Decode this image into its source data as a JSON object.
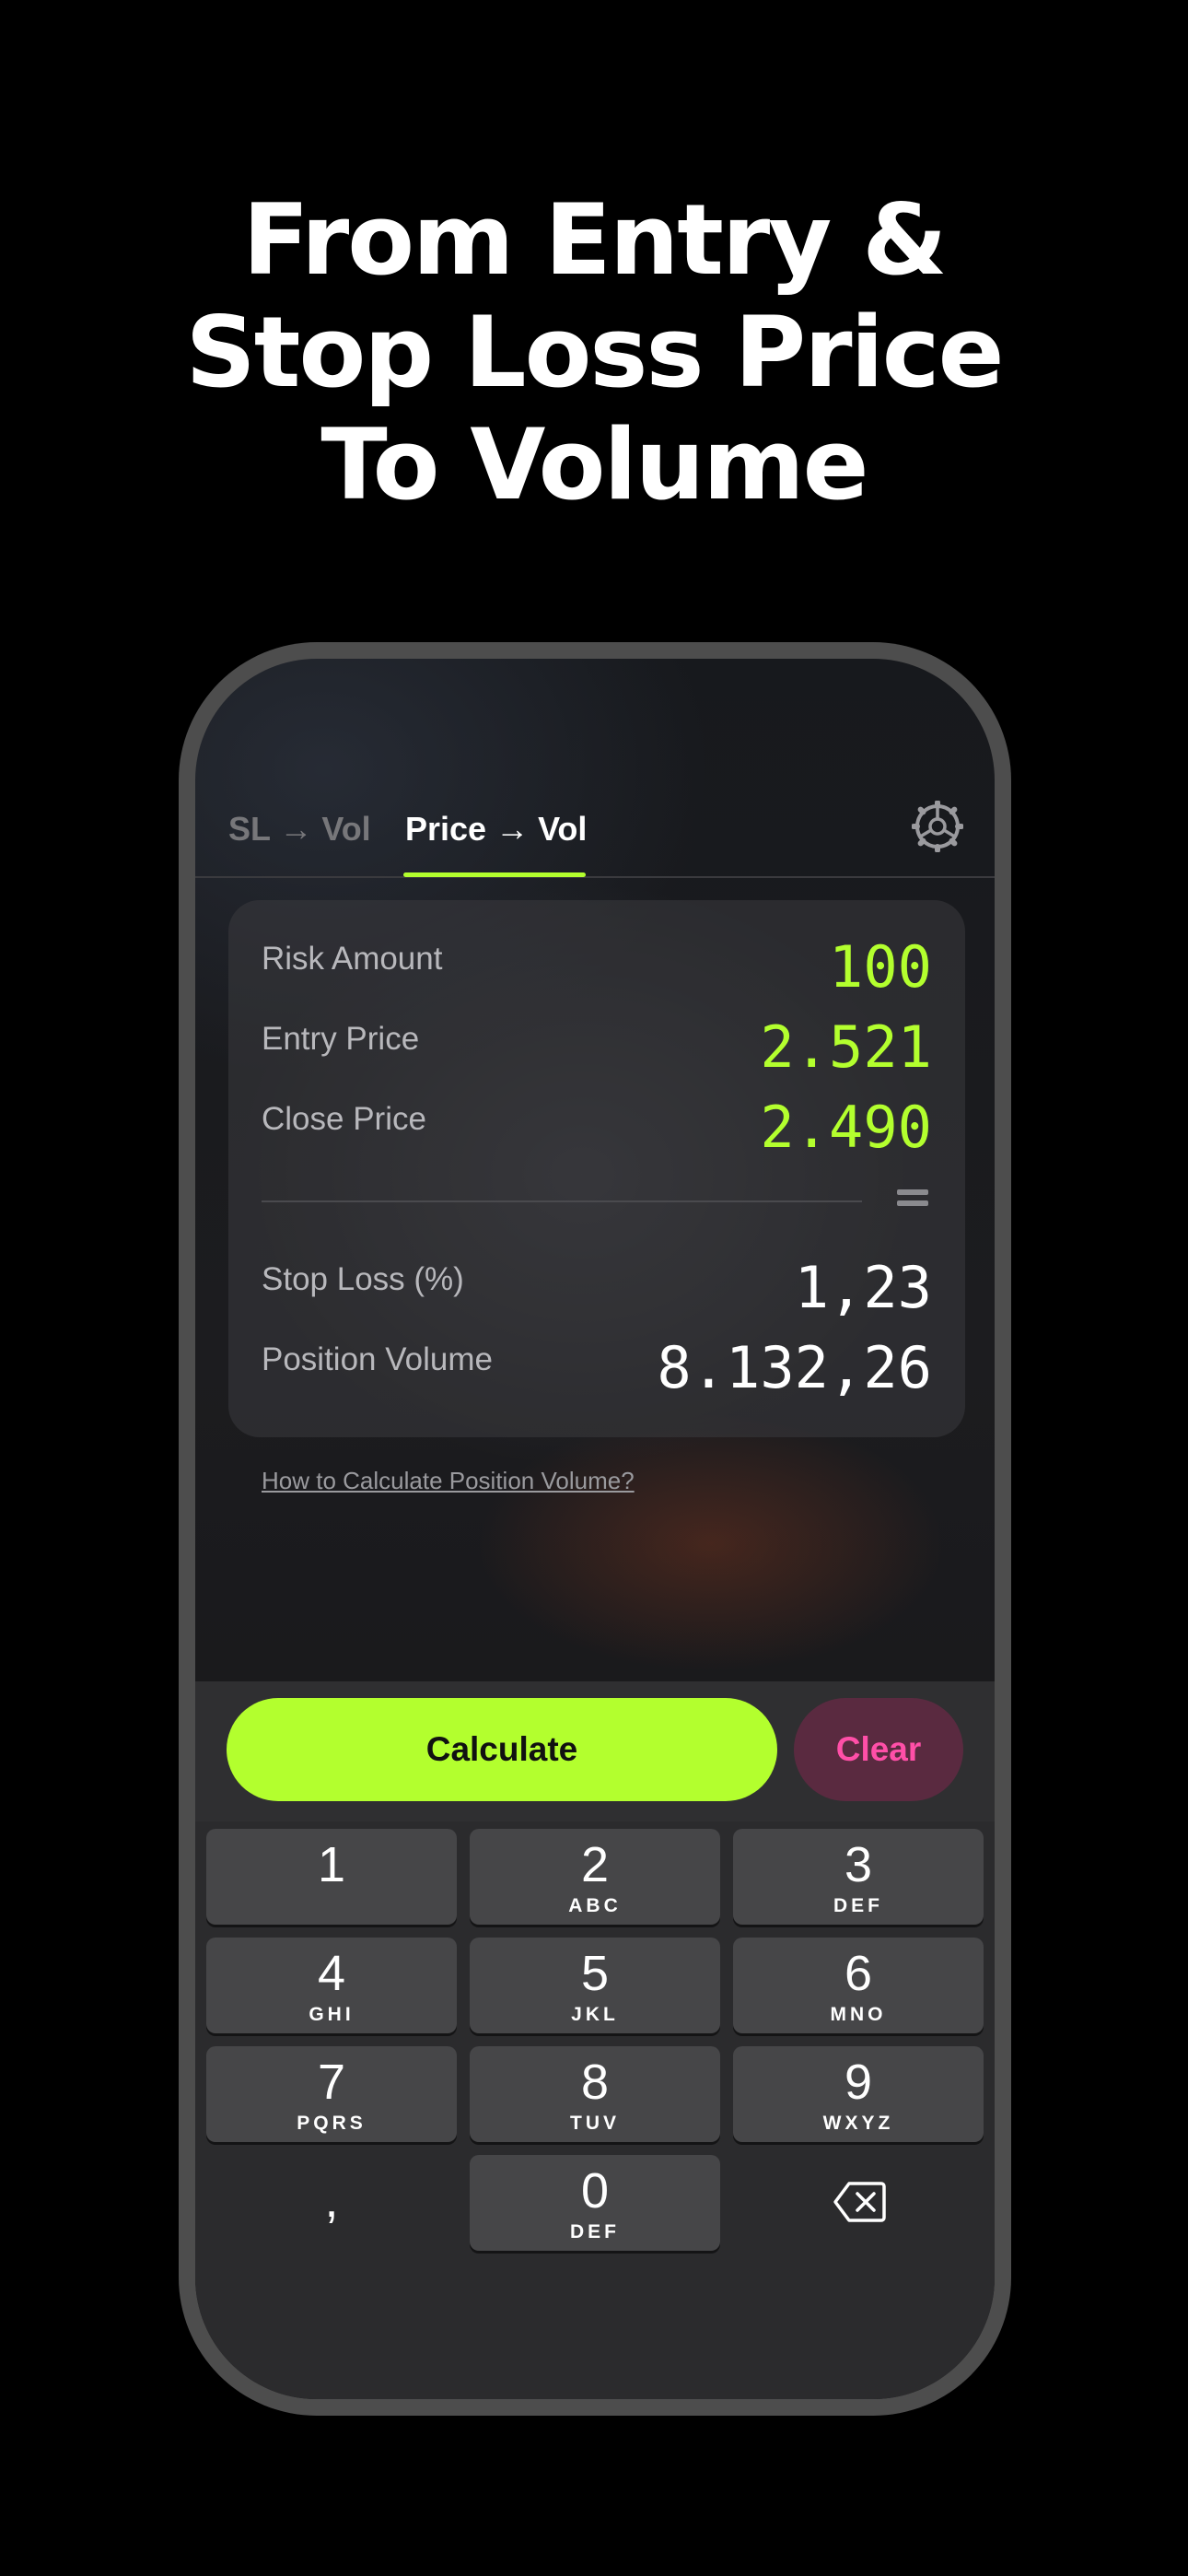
{
  "headline": [
    "From Entry &",
    "Stop Loss Price",
    "To Volume"
  ],
  "tabs": [
    {
      "label": "SL → Vol",
      "active": false
    },
    {
      "label": "Price → Vol",
      "active": true
    }
  ],
  "settings_icon": "gear-icon",
  "fields": {
    "risk_amount": {
      "label": "Risk Amount",
      "value": "100"
    },
    "entry_price": {
      "label": "Entry Price",
      "value": "2.521"
    },
    "close_price": {
      "label": "Close Price",
      "value": "2.490"
    },
    "stop_loss": {
      "label": "Stop Loss (%)",
      "value": "1,23"
    },
    "position_volume": {
      "label": "Position Volume",
      "value": "8.132,26"
    }
  },
  "equals_icon": "equals-icon",
  "help_link": "How to Calculate Position Volume?",
  "buttons": {
    "calculate": "Calculate",
    "clear": "Clear"
  },
  "keypad": [
    {
      "digit": "1",
      "letters": ""
    },
    {
      "digit": "2",
      "letters": "ABC"
    },
    {
      "digit": "3",
      "letters": "DEF"
    },
    {
      "digit": "4",
      "letters": "GHI"
    },
    {
      "digit": "5",
      "letters": "JKL"
    },
    {
      "digit": "6",
      "letters": "MNO"
    },
    {
      "digit": "7",
      "letters": "PQRS"
    },
    {
      "digit": "8",
      "letters": "TUV"
    },
    {
      "digit": "9",
      "letters": "WXYZ"
    },
    {
      "digit": ",",
      "letters": ""
    },
    {
      "digit": "0",
      "letters": "DEF"
    },
    {
      "digit": "",
      "letters": "",
      "icon": "backspace-icon"
    }
  ],
  "colors": {
    "accent": "#b3ff2e",
    "clear_text": "#ff4fa8",
    "clear_bg": "#5a2a40",
    "background": "#000000"
  }
}
